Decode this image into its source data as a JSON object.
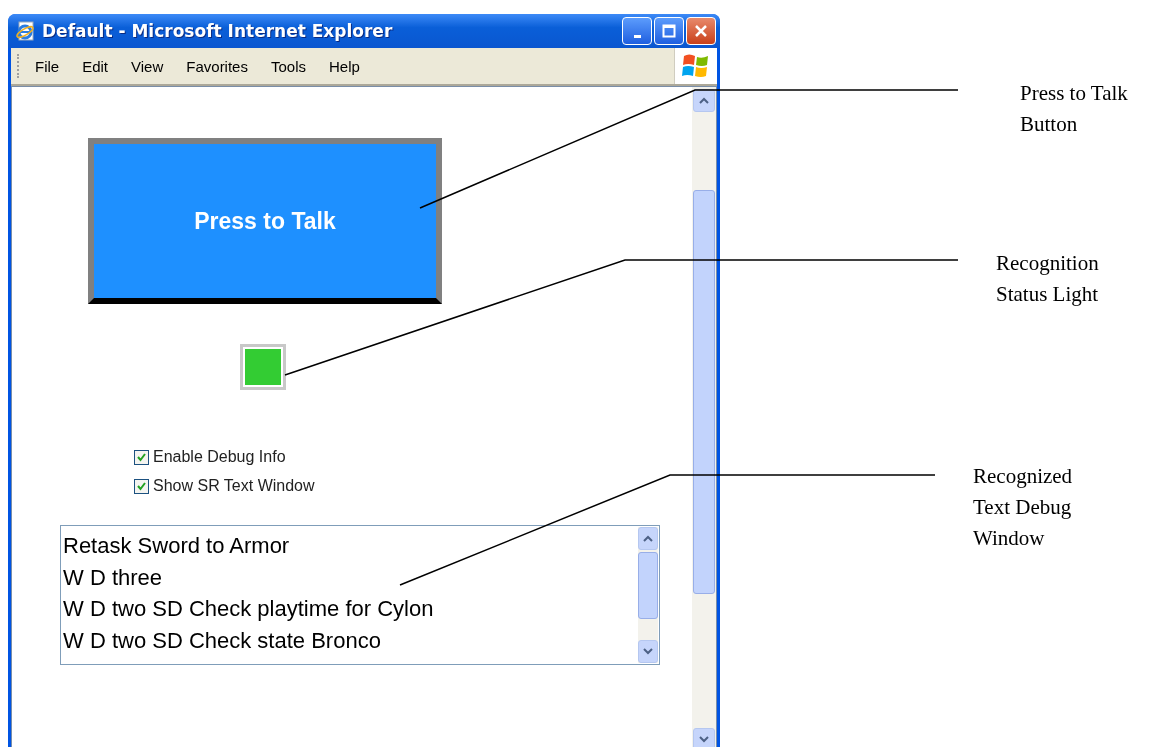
{
  "window": {
    "title": "Default - Microsoft Internet Explorer"
  },
  "menu": [
    "File",
    "Edit",
    "View",
    "Favorites",
    "Tools",
    "Help"
  ],
  "talk_button": {
    "label": "Press to Talk"
  },
  "status_light": {
    "on": true
  },
  "checkboxes": [
    {
      "label": "Enable Debug Info",
      "checked": true
    },
    {
      "label": "Show SR Text Window",
      "checked": true
    }
  ],
  "debug_text": [
    "Retask Sword to Armor",
    "W D three",
    "W D two SD Check playtime for Cylon",
    "W D two SD Check state Bronco"
  ],
  "annotations": [
    {
      "lines": [
        "Press to Talk",
        "Button"
      ]
    },
    {
      "lines": [
        "Recognition",
        "Status Light"
      ]
    },
    {
      "lines": [
        "Recognized",
        "Text Debug",
        "Window"
      ]
    }
  ]
}
